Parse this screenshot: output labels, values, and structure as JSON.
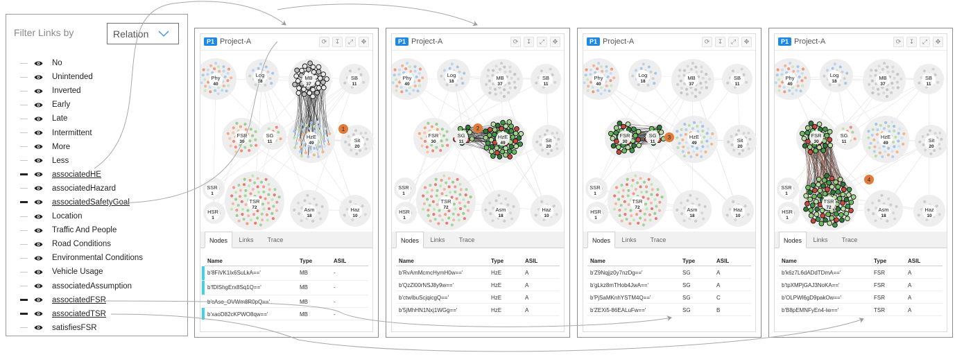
{
  "filter": {
    "title": "Filter Links by",
    "select_value": "Relation",
    "items": [
      {
        "label": "No",
        "active": false
      },
      {
        "label": "Unintended",
        "active": false
      },
      {
        "label": "Inverted",
        "active": false
      },
      {
        "label": "Early",
        "active": false
      },
      {
        "label": "Late",
        "active": false
      },
      {
        "label": "Intermittent",
        "active": false
      },
      {
        "label": "More",
        "active": false
      },
      {
        "label": "Less",
        "active": false
      },
      {
        "label": "associatedHE",
        "active": true
      },
      {
        "label": "associatedHazard",
        "active": false
      },
      {
        "label": "associatedSafetyGoal",
        "active": true
      },
      {
        "label": "Location",
        "active": false
      },
      {
        "label": "Traffic And People",
        "active": false
      },
      {
        "label": "Road Conditions",
        "active": false
      },
      {
        "label": "Environmental Conditions",
        "active": false
      },
      {
        "label": "Vehicle Usage",
        "active": false
      },
      {
        "label": "associatedAssumption",
        "active": false
      },
      {
        "label": "associatedFSR",
        "active": true
      },
      {
        "label": "associatedTSR",
        "active": true
      },
      {
        "label": "satisfiesFSR",
        "active": false
      }
    ]
  },
  "clusters": [
    {
      "id": "phy",
      "name": "Phy",
      "count": "40"
    },
    {
      "id": "log",
      "name": "Log",
      "count": "18"
    },
    {
      "id": "mb",
      "name": "MB",
      "count": "37"
    },
    {
      "id": "sb",
      "name": "SB",
      "count": "11"
    },
    {
      "id": "fsr",
      "name": "FSR",
      "count": "30"
    },
    {
      "id": "sg",
      "name": "SG",
      "count": "11"
    },
    {
      "id": "hze",
      "name": "HzE",
      "count": "49"
    },
    {
      "id": "sit",
      "name": "Sit",
      "count": "20"
    },
    {
      "id": "ssr",
      "name": "SSR",
      "count": "1"
    },
    {
      "id": "hsr",
      "name": "HSR",
      "count": "1"
    },
    {
      "id": "tsr",
      "name": "TSR",
      "count": "72"
    },
    {
      "id": "asm",
      "name": "Asm",
      "count": "18"
    },
    {
      "id": "haz",
      "name": "Haz",
      "count": "10"
    }
  ],
  "colors": {
    "accent_blue": "#1e88e5",
    "step_orange": "#e07b39",
    "highlight_cyan": "#3ed3e6",
    "node_green": "#2e8b3d"
  },
  "panels": [
    {
      "badge": "P1",
      "title": "Project-A",
      "step": "1",
      "tabs": [
        "Nodes",
        "Links",
        "Trace"
      ],
      "headers": {
        "name": "Name",
        "type": "Type",
        "asil": "ASIL"
      },
      "rows": [
        {
          "name": "b'8FiVK1lx6SuLkA=='",
          "type": "MB",
          "asil": "-",
          "highlight": true
        },
        {
          "name": "b'fDlShgErx8Sq1Q=='",
          "type": "MB",
          "asil": "-",
          "highlight": true
        },
        {
          "name": "b'cAso_OVWm8R0pQ=='",
          "type": "MB",
          "asil": "-",
          "highlight": false
        },
        {
          "name": "b'xaoD82cKPWO8qw=='",
          "type": "MB",
          "asil": "-",
          "highlight": true
        }
      ]
    },
    {
      "badge": "P1",
      "title": "Project-A",
      "step": "2",
      "tabs": [
        "Nodes",
        "Links",
        "Trace"
      ],
      "headers": {
        "name": "Name",
        "type": "Type",
        "asil": "ASIL"
      },
      "rows": [
        {
          "name": "b'RvAmMcmcHymH0w=='",
          "type": "HzE",
          "asil": "A",
          "highlight": false
        },
        {
          "name": "b'QzZl00rNSJ8y9w=='",
          "type": "HzE",
          "asil": "A",
          "highlight": false
        },
        {
          "name": "b'ctwIbuScjqicgQ=='",
          "type": "HzE",
          "asil": "A",
          "highlight": false
        },
        {
          "name": "b'5jMhHN1Nxj1WGg=='",
          "type": "HzE",
          "asil": "A",
          "highlight": false
        }
      ]
    },
    {
      "badge": "P1",
      "title": "Project-A",
      "step": "3",
      "tabs": [
        "Nodes",
        "Links",
        "Trace"
      ],
      "headers": {
        "name": "Name",
        "type": "Type",
        "asil": "ASIL"
      },
      "rows": [
        {
          "name": "b'Z9Nqjjz0y7nzDg=='",
          "type": "SG",
          "asil": "A",
          "highlight": false
        },
        {
          "name": "b'gLkz8mTHob4JwA=='",
          "type": "SG",
          "asil": "A",
          "highlight": false
        },
        {
          "name": "b'PjSaMKnhYSTM4Q=='",
          "type": "SG",
          "asil": "C",
          "highlight": false
        },
        {
          "name": "b'ZEXi5-86EALuFw=='",
          "type": "SG",
          "asil": "B",
          "highlight": false
        }
      ]
    },
    {
      "badge": "P1",
      "title": "Project-A",
      "step": "4",
      "tabs": [
        "Nodes",
        "Links",
        "Trace"
      ],
      "headers": {
        "name": "Name",
        "type": "Type",
        "asil": "ASIL"
      },
      "rows": [
        {
          "name": "b'k6z7L6dADdTDmA=='",
          "type": "FSR",
          "asil": "A",
          "highlight": false
        },
        {
          "name": "b'tpXMPjGAJ3NoKA=='",
          "type": "FSR",
          "asil": "A",
          "highlight": false
        },
        {
          "name": "b'OLPWl6gD9pakOw=='",
          "type": "FSR",
          "asil": "A",
          "highlight": false
        },
        {
          "name": "b'B8pEMNFyEn4-iw=='",
          "type": "TSR",
          "asil": "A",
          "highlight": false
        }
      ]
    }
  ]
}
